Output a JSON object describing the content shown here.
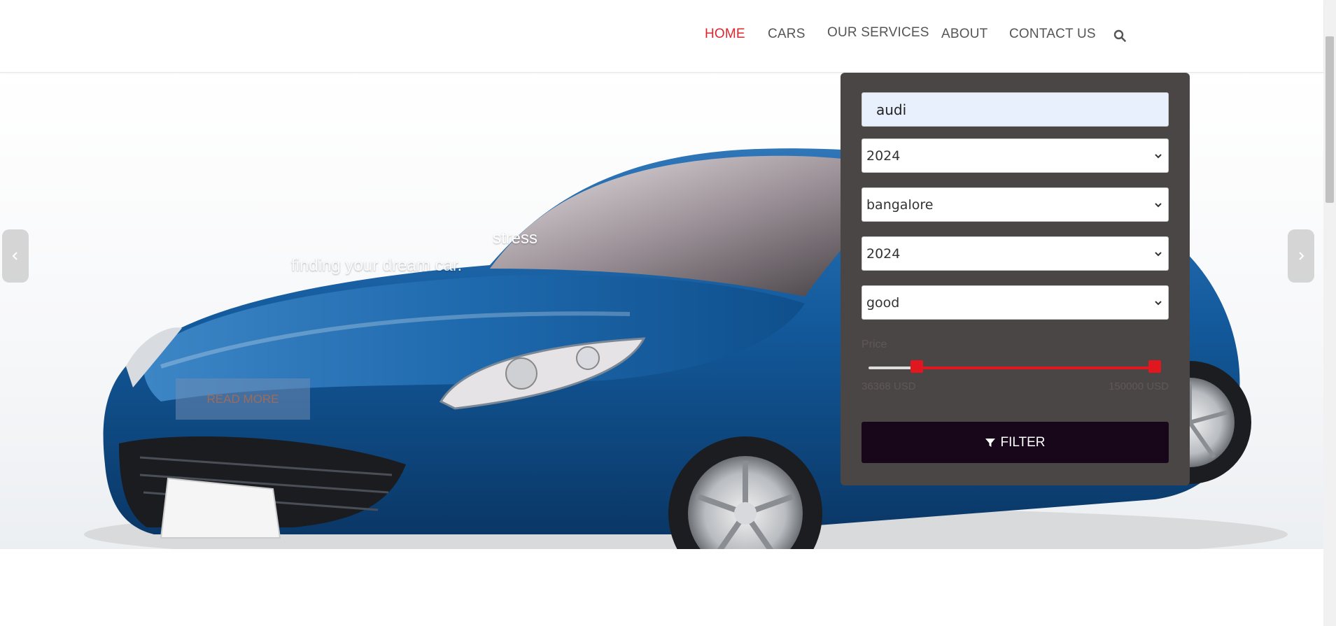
{
  "nav": {
    "items": [
      {
        "label": "HOME",
        "active": true
      },
      {
        "label": "CARS",
        "active": false
      },
      {
        "label": "OUR SERVICES",
        "active": false
      },
      {
        "label": "ABOUT",
        "active": false
      },
      {
        "label": "CONTACT US",
        "active": false
      }
    ],
    "search_icon": "search-icon",
    "active_color": "#e0252f"
  },
  "hero": {
    "line1": "stress",
    "line2": "finding your dream car.",
    "read_more": "READ MORE",
    "prev_icon": "chevron-left-icon",
    "next_icon": "chevron-right-icon"
  },
  "filter": {
    "search_value": "audi",
    "select_year_1": "2024",
    "select_city": "bangalore",
    "select_year_2": "2024",
    "select_condition": "good",
    "price_label": "Price",
    "price_min": "36368 USD",
    "price_max": "150000 USD",
    "price_min_fraction": 0.15,
    "price_max_fraction": 1.0,
    "button_label": "FILTER",
    "button_icon": "filter-icon",
    "accent": "#e0171f",
    "panel_bg": "#4b4646",
    "button_bg": "#18061a"
  }
}
